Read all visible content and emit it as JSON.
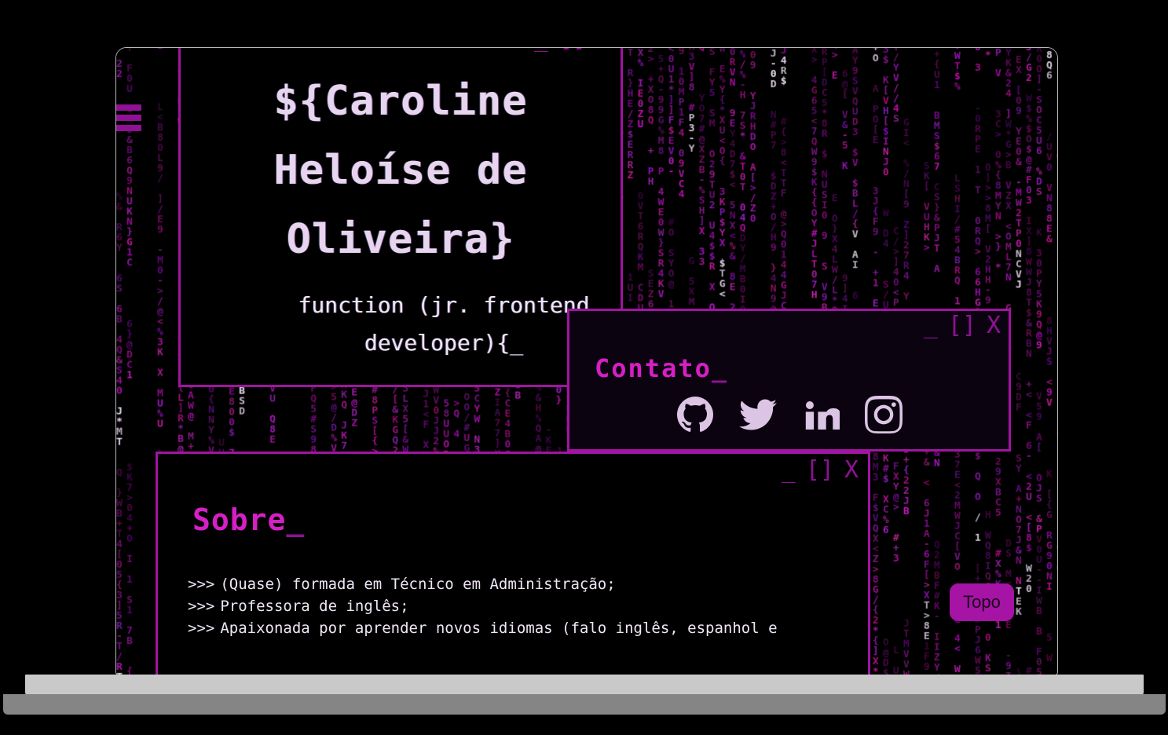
{
  "page": {
    "title": "${Caroline Heloíse de Oliveira}",
    "background_char_set": "01234567890ABCDEFGHIJKLMNOPQRSTUVWXYZ$#@%&*+-/<>[]{}",
    "colors": {
      "accent_magenta": "#d61fc4",
      "border_purple": "#a214a2",
      "control_purple": "#8f1194",
      "text_lavender": "#efe6f4",
      "window_dark": "#0b0310",
      "screen_black": "#000000",
      "laptop_frame": "#b9b9b9",
      "laptop_base_top": "#c9c9c9",
      "laptop_base_bottom": "#858585",
      "topo_button_bg": "#a514a5",
      "topo_button_text": "#1a0018"
    }
  },
  "nav": {
    "menu_icon": "hamburger-menu-icon"
  },
  "hero": {
    "title_lines": [
      "${Caroline",
      "Heloíse de",
      "Oliveira}"
    ],
    "subtitle_lines": [
      "function (jr. frontend",
      "developer){_"
    ],
    "window_controls": {
      "minimize": "_",
      "maximize": "[]",
      "close": "X"
    }
  },
  "contato": {
    "title": "Contato",
    "cursor": "_",
    "window_controls": {
      "minimize": "_",
      "maximize": "[]",
      "close": "X"
    },
    "social": [
      {
        "name": "github-icon",
        "label": "GitHub"
      },
      {
        "name": "twitter-icon",
        "label": "Twitter"
      },
      {
        "name": "linkedin-icon",
        "label": "LinkedIn"
      },
      {
        "name": "instagram-icon",
        "label": "Instagram"
      }
    ]
  },
  "sobre": {
    "title": "Sobre",
    "cursor": "_",
    "window_controls": {
      "minimize": "_",
      "maximize": "[]",
      "close": "X"
    },
    "bullet": ">>>",
    "items": [
      "(Quase) formada em Técnico em Administração;",
      "Professora de inglês;",
      "Apaixonada por aprender novos idiomas (falo inglês, espanhol e"
    ]
  },
  "topo": {
    "label": "Topo"
  }
}
